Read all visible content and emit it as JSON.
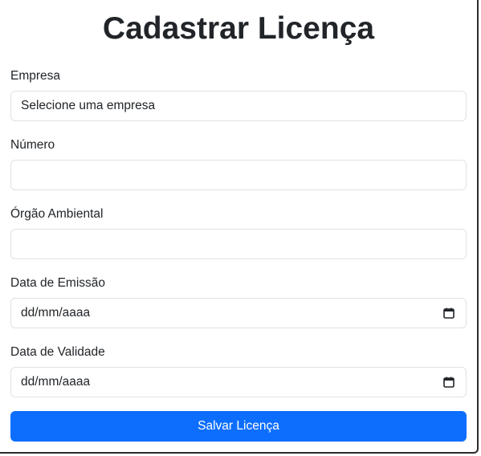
{
  "form": {
    "title": "Cadastrar Licença",
    "empresa": {
      "label": "Empresa",
      "selected": "Selecione uma empresa"
    },
    "numero": {
      "label": "Número",
      "value": ""
    },
    "orgao": {
      "label": "Órgão Ambiental",
      "value": ""
    },
    "data_emissao": {
      "label": "Data de Emissão",
      "value": "dd/mm/aaaa",
      "icon": "calendar-icon"
    },
    "data_validade": {
      "label": "Data de Validade",
      "value": "dd/mm/aaaa",
      "icon": "calendar-icon"
    },
    "submit_label": "Salvar Licença"
  },
  "colors": {
    "accent": "#0d6efd",
    "border": "#dee2e6",
    "text": "#212529"
  }
}
